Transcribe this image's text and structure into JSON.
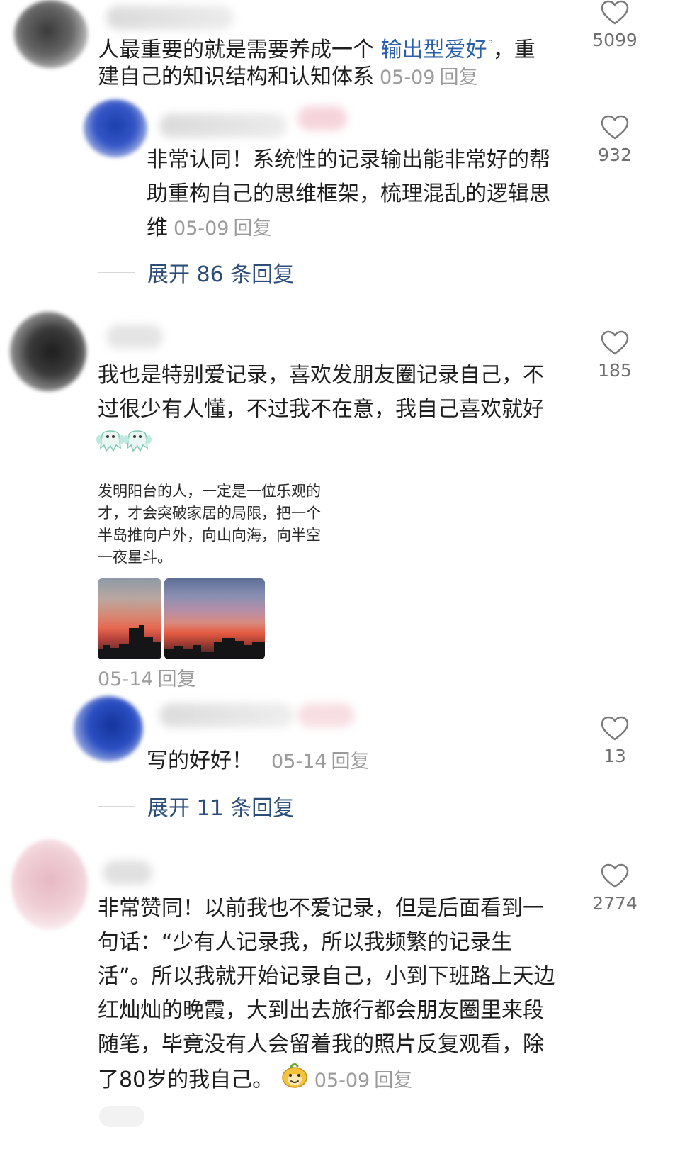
{
  "comments": [
    {
      "text_before": "人最重要的就是需要养成一个 ",
      "link": "输出型爱好",
      "text_after_line1": "，重",
      "line2": "建自己的知识结构和认知体系",
      "date": "05-09",
      "reply": "回复",
      "likes": "5099",
      "replies": [
        {
          "line1": "非常认同！系统性的记录输出能非常好的帮",
          "line2": "助重构自己的思维框架，梳理混乱的逻辑思",
          "line3": "维",
          "date": "05-09",
          "reply": "回复",
          "likes": "932"
        }
      ],
      "expand_label": "展开 86 条回复"
    },
    {
      "line1": "我也是特别爱记录，喜欢发朋友圈记录自己，不",
      "line2": "过很少有人懂，不过我不在意，我自己喜欢就好",
      "quote_lines": [
        "发明阳台的人，一定是一位乐观的",
        "才，才会突破家居的局限，把一个",
        "半岛推向户外，向山向海，向半空",
        "一夜星斗。"
      ],
      "date": "05-14",
      "reply": "回复",
      "likes": "185",
      "replies": [
        {
          "line1": "写的好好！",
          "date": "05-14",
          "reply": "回复",
          "likes": "13"
        }
      ],
      "expand_label": "展开 11 条回复"
    },
    {
      "line1": "非常赞同！以前我也不爱记录，但是后面看到一",
      "line2": "句话：“少有人记录我，所以我频繁的记录生",
      "line3": "活”。所以我就开始记录自己，小到下班路上天边",
      "line4": "红灿灿的晚霞，大到出去旅行都会朋友圈里来段",
      "line5": "随笔，毕竟没有人会留着我的照片反复观看，除",
      "line6": "了80岁的我自己。",
      "date": "05-09",
      "reply": "回复",
      "likes": "2774"
    }
  ],
  "icons": {
    "like": "heart-outline-icon",
    "search": "search-icon",
    "emoji_ghost": "ghost-emoji-icon",
    "emoji_face": "smiling-face-emoji-icon"
  },
  "colors": {
    "link": "#2b5fa8",
    "expand": "#2b4d78",
    "meta": "#9b9b9b"
  }
}
